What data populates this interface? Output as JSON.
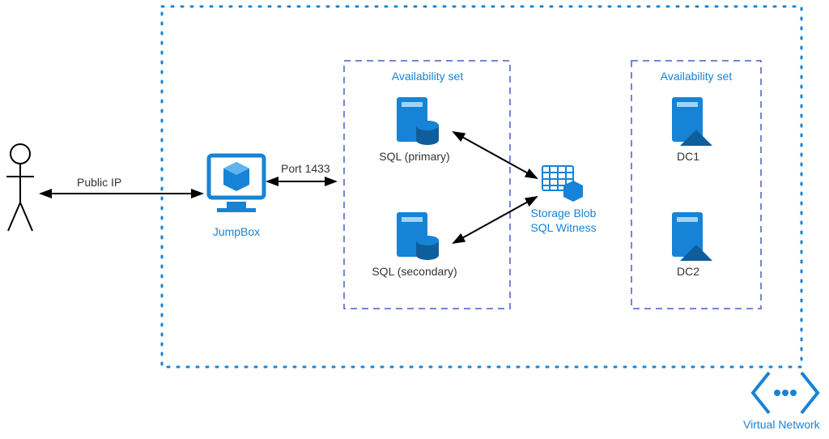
{
  "colors": {
    "azure": "#1783d6",
    "dark": "#2f2f2f",
    "black": "#000"
  },
  "vnet": {
    "label": "Virtual Network"
  },
  "user": {
    "connLabel": "Public IP"
  },
  "jumpbox": {
    "label": "JumpBox",
    "portLabel": "Port 1433"
  },
  "sqlSet": {
    "title": "Availability set",
    "primary": "SQL (primary)",
    "secondary": "SQL (secondary)"
  },
  "storage": {
    "line1": "Storage Blob",
    "line2": "SQL Witness"
  },
  "dcSet": {
    "title": "Availability set",
    "dc1": "DC1",
    "dc2": "DC2"
  }
}
